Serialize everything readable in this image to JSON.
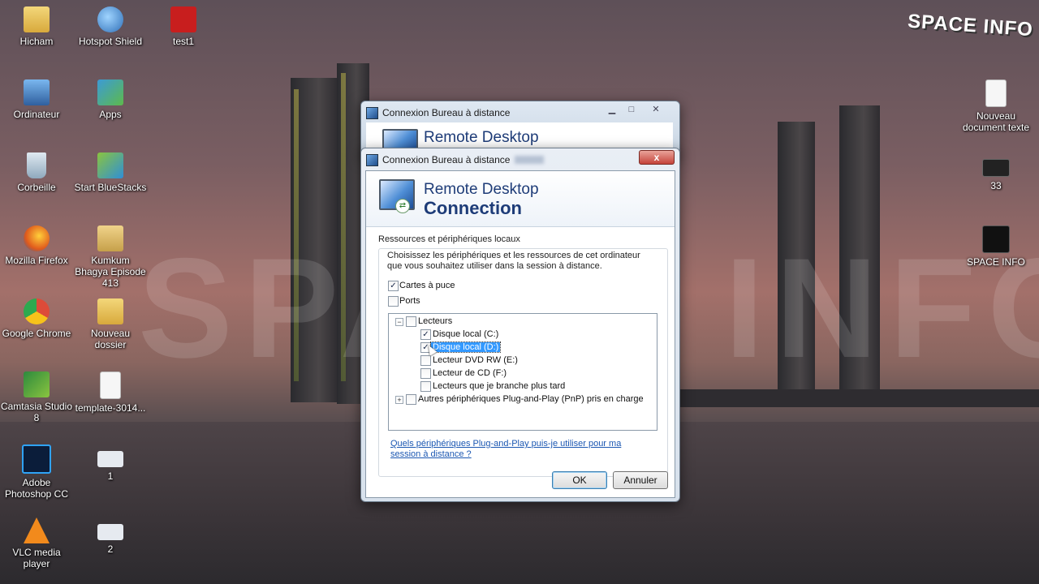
{
  "desktop_icons": [
    {
      "label": "Hicham",
      "icon": "folder-icon"
    },
    {
      "label": "Hotspot Shield",
      "icon": "shield-icon"
    },
    {
      "label": "test1",
      "icon": "video-file-icon"
    },
    {
      "label": "Ordinateur",
      "icon": "computer-icon"
    },
    {
      "label": "Apps",
      "icon": "apps-icon"
    },
    {
      "label": "Corbeille",
      "icon": "recycle-bin-icon"
    },
    {
      "label": "Start BlueStacks",
      "icon": "bluestacks-icon"
    },
    {
      "label": "Mozilla Firefox",
      "icon": "firefox-icon"
    },
    {
      "label": "Kumkum Bhagya Episode 413",
      "icon": "folder-icon"
    },
    {
      "label": "Google Chrome",
      "icon": "chrome-icon"
    },
    {
      "label": "Nouveau dossier",
      "icon": "folder-icon"
    },
    {
      "label": "Camtasia Studio 8",
      "icon": "camtasia-icon"
    },
    {
      "label": "template-3014...",
      "icon": "document-icon"
    },
    {
      "label": "Adobe Photoshop CC",
      "icon": "photoshop-icon"
    },
    {
      "label": "1",
      "icon": "image-file-icon"
    },
    {
      "label": "VLC media player",
      "icon": "vlc-icon"
    },
    {
      "label": "2",
      "icon": "image-file-icon"
    },
    {
      "label": "Nouveau document texte",
      "icon": "text-file-icon"
    },
    {
      "label": "33",
      "icon": "image-file-icon"
    },
    {
      "label": "SPACE INFO",
      "icon": "space-info-icon"
    }
  ],
  "watermark": "SPACE INFO",
  "brand_overlay": "SPACE INFO",
  "back_window": {
    "title": "Connexion Bureau à distance",
    "banner_title": "Remote Desktop"
  },
  "dialog": {
    "title": "Connexion Bureau à distance",
    "banner_line1": "Remote Desktop",
    "banner_line2": "Connection",
    "close_label": "x",
    "group_label": "Ressources et périphériques locaux",
    "description": "Choisissez les périphériques et les ressources de cet ordinateur que vous souhaitez utiliser dans la session à distance.",
    "options": [
      {
        "label": "Cartes à puce",
        "checked": true
      },
      {
        "label": "Ports",
        "checked": false
      }
    ],
    "tree": [
      {
        "label": "Lecteurs",
        "checked": false,
        "expander": "−"
      },
      {
        "label": "Disque local (C:)",
        "checked": true
      },
      {
        "label": "Disque local (D:)",
        "checked": true,
        "selected": true
      },
      {
        "label": "Lecteur DVD RW (E:)",
        "checked": false
      },
      {
        "label": "Lecteur de CD (F:)",
        "checked": false
      },
      {
        "label": "Lecteurs que je branche plus tard",
        "checked": false
      },
      {
        "label": "Autres périphériques Plug-and-Play (PnP) pris en charge",
        "checked": false,
        "expander": "+"
      }
    ],
    "help_link": "Quels périphériques Plug-and-Play puis-je utiliser pour ma session à distance ?",
    "ok_label": "OK",
    "cancel_label": "Annuler"
  },
  "colors": {
    "accent": "#1e3c78",
    "selection": "#3399ff",
    "link": "#1b57b2"
  }
}
